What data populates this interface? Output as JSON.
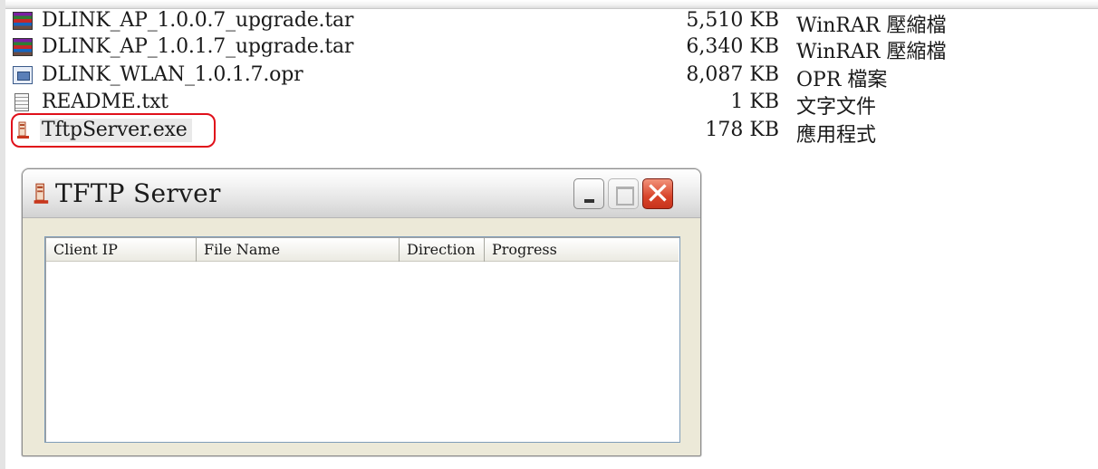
{
  "explorer": {
    "files": [
      {
        "name": "DLINK_AP_1.0.0.7_upgrade.tar",
        "size": "5,510 KB",
        "type": "WinRAR 壓縮檔",
        "icon": "winrar-archive-icon"
      },
      {
        "name": "DLINK_AP_1.0.1.7_upgrade.tar",
        "size": "6,340 KB",
        "type": "WinRAR 壓縮檔",
        "icon": "winrar-archive-icon"
      },
      {
        "name": "DLINK_WLAN_1.0.1.7.opr",
        "size": "8,087 KB",
        "type": "OPR 檔案",
        "icon": "opr-file-icon"
      },
      {
        "name": "README.txt",
        "size": "1 KB",
        "type": "文字文件",
        "icon": "text-document-icon"
      },
      {
        "name": "TftpServer.exe",
        "size": "178 KB",
        "type": "應用程式",
        "icon": "tftp-server-exe-icon"
      }
    ],
    "highlight_color": "#e0101a"
  },
  "tftp_window": {
    "title": "TFTP Server",
    "columns": [
      "Client IP",
      "File Name",
      "Direction",
      "Progress"
    ],
    "rows": []
  }
}
